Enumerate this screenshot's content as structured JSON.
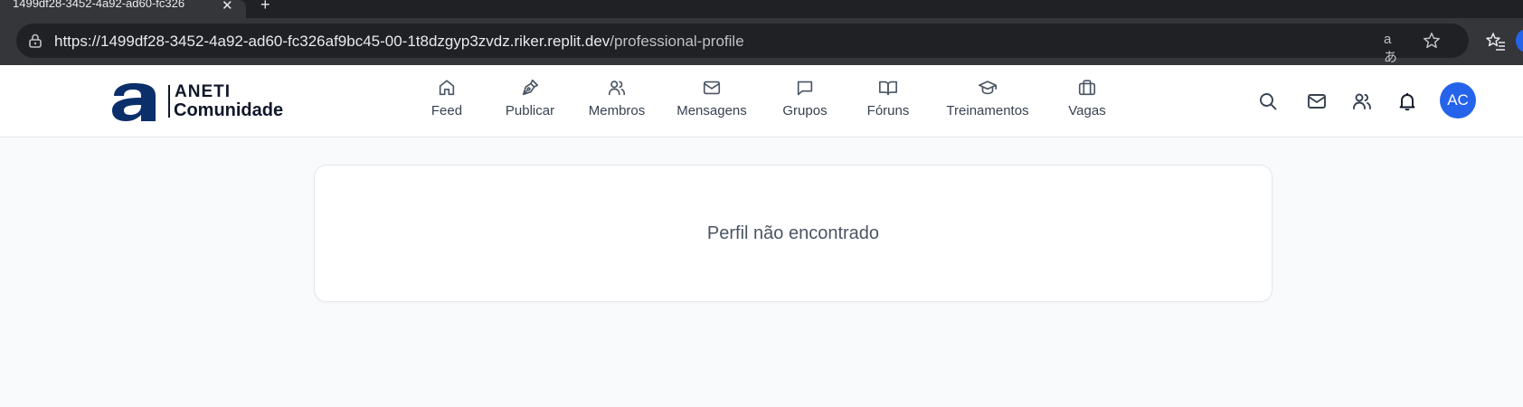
{
  "browser": {
    "tab_title": "1499df28-3452-4a92-ad60-fc326",
    "url_host": "https://1499df28-3452-4a92-ad60-fc326af9bc45-00-1t8dzgyp3zvdz.riker.replit.dev",
    "url_path": "/professional-profile",
    "translate_glyph": "aあ"
  },
  "brand": {
    "name": "ANETI",
    "subtitle": "Comunidade",
    "color": "#0b2f6b"
  },
  "nav": {
    "items": [
      {
        "label": "Feed",
        "icon": "home-icon"
      },
      {
        "label": "Publicar",
        "icon": "pen-icon"
      },
      {
        "label": "Membros",
        "icon": "users-icon"
      },
      {
        "label": "Mensagens",
        "icon": "mail-icon"
      },
      {
        "label": "Grupos",
        "icon": "chat-icon"
      },
      {
        "label": "Fóruns",
        "icon": "book-icon"
      },
      {
        "label": "Treinamentos",
        "icon": "graduation-cap-icon"
      },
      {
        "label": "Vagas",
        "icon": "briefcase-icon"
      }
    ]
  },
  "header_actions": {
    "avatar_initials": "AC",
    "accent": "#2563eb"
  },
  "main": {
    "message": "Perfil não encontrado"
  }
}
